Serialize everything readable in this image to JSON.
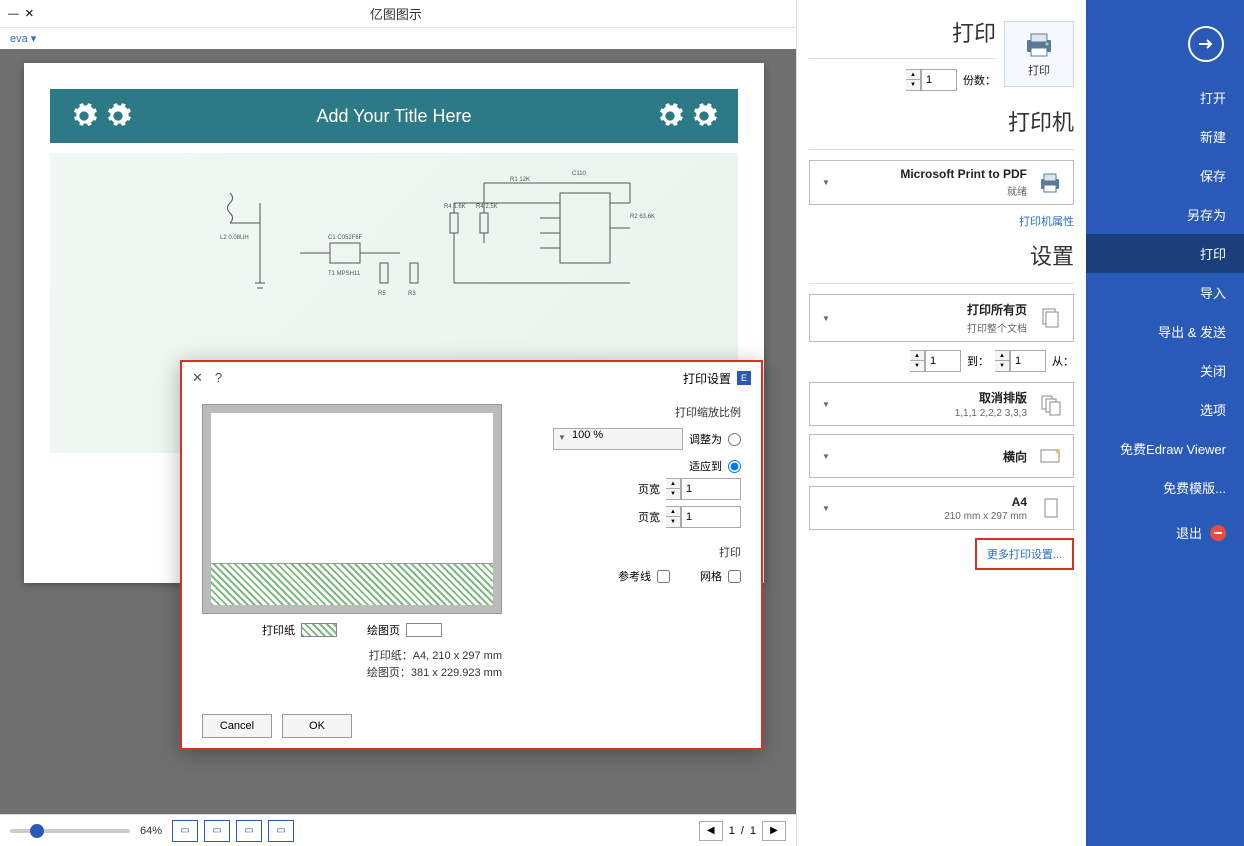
{
  "window": {
    "title": "亿图图示",
    "save_label": "eva",
    "close": "×",
    "minimize": "—"
  },
  "sidebar": {
    "items": [
      {
        "label": "打开"
      },
      {
        "label": "新建"
      },
      {
        "label": "保存"
      },
      {
        "label": "另存为"
      },
      {
        "label": "打印"
      },
      {
        "label": "导入"
      },
      {
        "label": "导出 & 发送"
      },
      {
        "label": "关闭"
      },
      {
        "label": "选项"
      },
      {
        "label": "免费Edraw Viewer"
      },
      {
        "label": "免费模版..."
      }
    ],
    "exit_label": "退出"
  },
  "panel": {
    "print_heading": "打印",
    "print_btn_label": "打印",
    "copies_label": "份数：",
    "copies_value": "1",
    "printer_heading": "打印机",
    "printer_name": "Microsoft Print to PDF",
    "printer_status": "就绪",
    "printer_props_link": "打印机属性",
    "settings_heading": "设置",
    "all_pages_title": "打印所有页",
    "all_pages_sub": "打印整个文档",
    "range_from_label": "从：",
    "range_from_value": "1",
    "range_to_label": "到：",
    "range_to_value": "1",
    "layout_title": "取消排版",
    "layout_sub": "1,1,1  2,2,2  3,3,3",
    "orientation_title": "横向",
    "paper_title": "A4",
    "paper_sub": "210 mm x 297 mm",
    "more_link": "更多打印设置..."
  },
  "doc": {
    "header_title": "Add Your Title Here"
  },
  "zoom": {
    "percent": "64%",
    "page_now": "1",
    "page_total": "1"
  },
  "dialog": {
    "title": "打印设置",
    "group_scale": "打印缩放比例",
    "radio_adjust": "调整为",
    "adjust_percent": "100 %",
    "radio_fit": "适应到",
    "width_label": "页宽",
    "width_value": "1",
    "height_label": "页宽",
    "height_value": "1",
    "group_print": "打印",
    "check_grid": "网格",
    "check_ref": "参考线",
    "legend_print": "打印纸",
    "legend_draw": "绘图页",
    "info_print": "打印纸：A4, 210 x 297 mm",
    "info_draw": "绘图页：381 x 229.923 mm",
    "btn_ok": "OK",
    "btn_cancel": "Cancel"
  }
}
